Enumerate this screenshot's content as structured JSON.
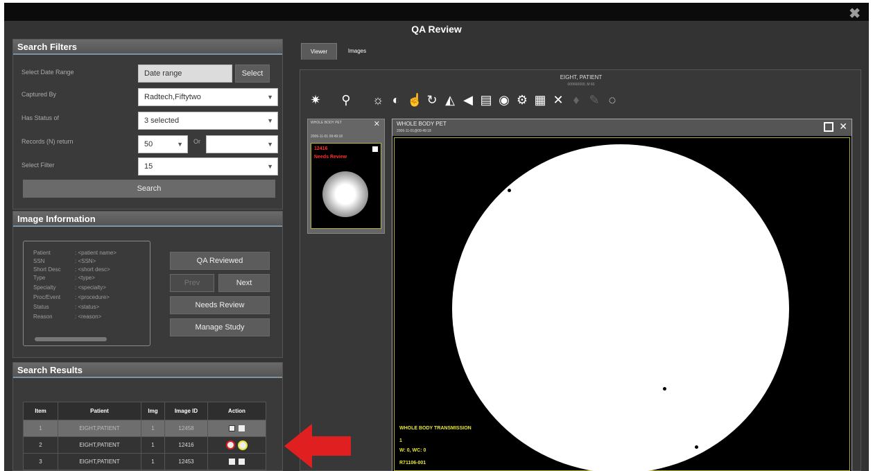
{
  "window": {
    "title": "QA Review",
    "close_glyph": "✖"
  },
  "tabs": [
    {
      "label": "Viewer",
      "active": true
    },
    {
      "label": "Images",
      "active": false
    }
  ],
  "search_filters": {
    "heading": "Search Filters",
    "date_range": {
      "label": "Select Date Range",
      "value": "Date range",
      "button": "Select"
    },
    "captured_by": {
      "label": "Captured By",
      "value": "Radtech,Fiftytwo"
    },
    "status": {
      "label": "Has Status of",
      "value": "3 selected"
    },
    "records": {
      "label": "Records (N) return",
      "value": "50",
      "or_label": "Or",
      "alt_value": ""
    },
    "select_filter": {
      "label": "Select Filter",
      "value": "15"
    },
    "search_button": "Search"
  },
  "image_info": {
    "heading": "Image Information",
    "fields": [
      {
        "label": "Patient",
        "value": ": <patient name>"
      },
      {
        "label": "SSN",
        "value": ": <SSN>"
      },
      {
        "label": "Short Desc",
        "value": ": <short desc>"
      },
      {
        "label": "Type",
        "value": ": <type>"
      },
      {
        "label": "Specialty",
        "value": ": <specialty>"
      },
      {
        "label": "Proc/Event",
        "value": ": <procedure>"
      },
      {
        "label": "Status",
        "value": ": <status>"
      },
      {
        "label": "Reason",
        "value": ": <reason>"
      }
    ],
    "buttons": {
      "qa_reviewed": "QA Reviewed",
      "prev": "Prev",
      "next": "Next",
      "needs_review": "Needs Review",
      "manage_study": "Manage Study"
    }
  },
  "search_results": {
    "heading": "Search Results",
    "columns": [
      "Item",
      "Patient",
      "Img",
      "Image ID",
      "Action"
    ],
    "rows": [
      {
        "item": "1",
        "patient": "EIGHT,PATIENT",
        "img": "1",
        "image_id": "12458",
        "selected": true
      },
      {
        "item": "2",
        "patient": "EIGHT,PATIENT",
        "img": "1",
        "image_id": "12416",
        "selected": false
      },
      {
        "item": "3",
        "patient": "EIGHT,PATIENT",
        "img": "1",
        "image_id": "12453",
        "selected": false
      }
    ]
  },
  "viewer": {
    "patient_name": "EIGHT, PATIENT",
    "patient_sub": "000660000, M 60",
    "toolbar_icons": [
      "brightness-icon",
      "zoom-icon",
      "window-level-icon",
      "invert-icon",
      "pan-icon",
      "rotate-icon",
      "flip-icon",
      "measure-icon",
      "document-icon",
      "eye-icon",
      "settings-icon",
      "grid-icon",
      "tools-icon",
      "cine-icon",
      "link-icon",
      "reset-icon"
    ],
    "thumbnail": {
      "title": "WHOLE BODY PET",
      "date": "2006-11-01 09:49:18",
      "image_id": "12416",
      "status": "Needs Review"
    },
    "main": {
      "series_title": "WHOLE BODY PET",
      "series_date": "2006-11-01@09:49:18",
      "overlay_line1": "WHOLE BODY TRANSMISSION",
      "overlay_line2": "1",
      "overlay_line3": "W: 0, WC: 0",
      "overlay_line4": "R71106-001"
    }
  },
  "colors": {
    "accent": "#7d93a6",
    "alert": "#ff3030",
    "frame": "#b8b830",
    "arrow": "#e02020"
  }
}
